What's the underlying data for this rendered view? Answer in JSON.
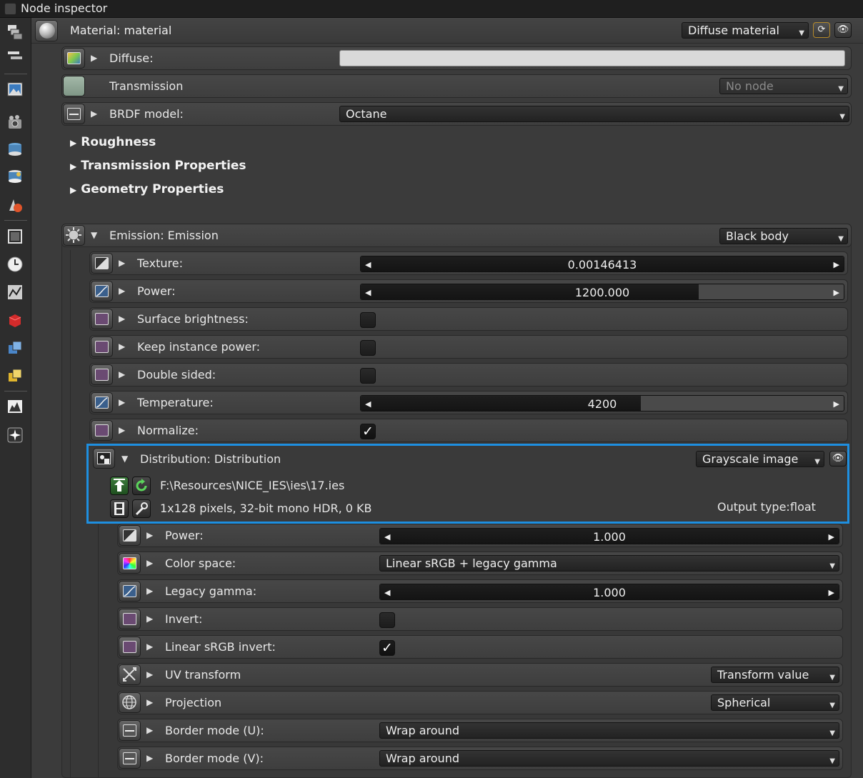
{
  "window": {
    "title": "Node inspector"
  },
  "material": {
    "title": "Material: material",
    "type_dropdown": "Diffuse material"
  },
  "pins": {
    "diffuse": {
      "label": "Diffuse:",
      "color": "#d9d9d9"
    },
    "transmission": {
      "label": "Transmission",
      "value": "No node"
    },
    "brdf": {
      "label": "BRDF model:",
      "value": "Octane"
    }
  },
  "groups": [
    "Roughness",
    "Transmission Properties",
    "Geometry Properties"
  ],
  "emission": {
    "label": "Emission: Emission",
    "type": "Black body",
    "texture": {
      "label": "Texture:",
      "value": "0.00146413",
      "fraction": 1.0
    },
    "power": {
      "label": "Power:",
      "value": "1200.000",
      "fraction": 0.7
    },
    "surface_brightness": {
      "label": "Surface brightness:",
      "checked": false
    },
    "keep_instance_power": {
      "label": "Keep instance power:",
      "checked": false
    },
    "double_sided": {
      "label": "Double sided:",
      "checked": false
    },
    "temperature": {
      "label": "Temperature:",
      "value": "4200",
      "fraction": 0.58
    },
    "normalize": {
      "label": "Normalize:",
      "checked": true
    }
  },
  "distribution": {
    "label": "Distribution: Distribution",
    "type": "Grayscale image",
    "file_path": "F:\\Resources\\NICE_IES\\ies\\17.ies",
    "info": "1x128 pixels, 32-bit mono HDR, 0 KB",
    "output_type_label": "Output type:",
    "output_type_value": "float",
    "power": {
      "label": "Power:",
      "value": "1.000",
      "fraction": 1.0
    },
    "color_space": {
      "label": "Color space:",
      "value": "Linear sRGB + legacy gamma"
    },
    "legacy_gamma": {
      "label": "Legacy gamma:",
      "value": "1.000",
      "fraction": 1.0
    },
    "invert": {
      "label": "Invert:",
      "checked": false
    },
    "linear_srgb_invert": {
      "label": "Linear sRGB invert:",
      "checked": true
    },
    "uv_transform": {
      "label": "UV transform",
      "value": "Transform value"
    },
    "projection": {
      "label": "Projection",
      "value": "Spherical"
    },
    "border_u": {
      "label": "Border mode (U):",
      "value": "Wrap around"
    },
    "border_v": {
      "label": "Border mode (V):",
      "value": "Wrap around"
    }
  },
  "glyphs": {
    "tri_right": "▶",
    "tri_down": "▼",
    "arrow_left": "◀",
    "arrow_right": "▶",
    "dd_arrow": "▼",
    "check": "✓"
  },
  "sidebar_icons": [
    "layers-icon",
    "outliner-icon",
    "image-icon",
    "camera-icon",
    "database-icon",
    "database-icon-2",
    "shapes-icon",
    "frame-icon",
    "clock-icon",
    "graph-icon",
    "red-cube-icon",
    "blue-cubes-icon",
    "yellow-cubes-icon",
    "histogram-icon",
    "burst-icon"
  ],
  "accent": {
    "highlight": "#1e8fe0"
  }
}
